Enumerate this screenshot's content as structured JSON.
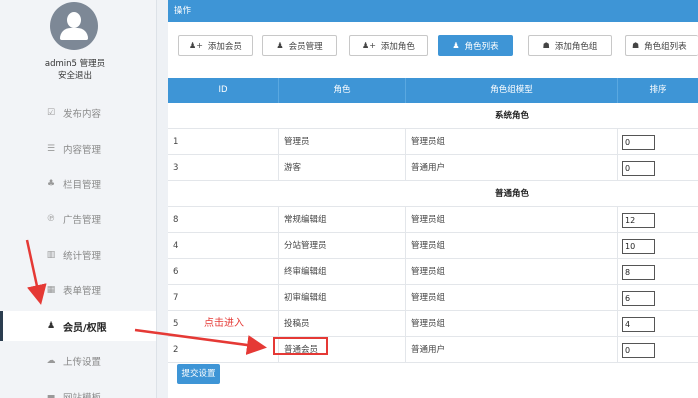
{
  "sidebar": {
    "user": {
      "name": "admin5 管理员",
      "logout": "安全退出"
    },
    "items": [
      {
        "label": "发布内容",
        "icon": "edit-icon",
        "glyph": "☑"
      },
      {
        "label": "内容管理",
        "icon": "list-icon",
        "glyph": "☰"
      },
      {
        "label": "栏目管理",
        "icon": "sitemap-icon",
        "glyph": "♣"
      },
      {
        "label": "广告管理",
        "icon": "pin-icon",
        "glyph": "℗"
      },
      {
        "label": "统计管理",
        "icon": "bar-chart-icon",
        "glyph": "▥"
      },
      {
        "label": "表单管理",
        "icon": "table-icon",
        "glyph": "▦"
      },
      {
        "label": "会员/权限",
        "icon": "user-icon",
        "glyph": "♟"
      },
      {
        "label": "上传设置",
        "icon": "cloud-upload-icon",
        "glyph": "☁"
      },
      {
        "label": "网站模板",
        "icon": "template-icon",
        "glyph": "▬"
      }
    ]
  },
  "main": {
    "header": "操作",
    "buttons": [
      {
        "label": "添加会员",
        "icon": "add-user-icon",
        "glyph": "♟+"
      },
      {
        "label": "会员管理",
        "icon": "user-icon",
        "glyph": "♟"
      },
      {
        "label": "添加角色",
        "icon": "add-user-icon",
        "glyph": "♟+"
      },
      {
        "label": "角色列表",
        "icon": "user-icon",
        "glyph": "♟"
      },
      {
        "label": "添加角色组",
        "icon": "group-icon",
        "glyph": "☗"
      },
      {
        "label": "角色组列表",
        "icon": "group-icon",
        "glyph": "☗"
      }
    ],
    "table": {
      "columns": [
        "ID",
        "角色",
        "角色组模型",
        "排序"
      ],
      "groups": [
        {
          "title": "系统角色",
          "rows": [
            {
              "id": "1",
              "role": "管理员",
              "model": "管理员组",
              "sort": "0"
            },
            {
              "id": "3",
              "role": "游客",
              "model": "普通用户",
              "sort": "0"
            }
          ]
        },
        {
          "title": "普通角色",
          "rows": [
            {
              "id": "8",
              "role": "常规编辑组",
              "model": "管理员组",
              "sort": "12"
            },
            {
              "id": "4",
              "role": "分站管理员",
              "model": "管理员组",
              "sort": "10"
            },
            {
              "id": "6",
              "role": "终审编辑组",
              "model": "管理员组",
              "sort": "8"
            },
            {
              "id": "7",
              "role": "初审编辑组",
              "model": "管理员组",
              "sort": "6"
            },
            {
              "id": "5",
              "role": "投稿员",
              "model": "管理员组",
              "sort": "4"
            },
            {
              "id": "2",
              "role": "普通会员",
              "model": "普通用户",
              "sort": "0"
            }
          ]
        }
      ]
    },
    "submit_label": "提交设置"
  },
  "annotation": {
    "text": "点击进入",
    "color": "#e53935"
  },
  "colors": {
    "accent": "#3e95d6",
    "sidebar_bg": "#f2f4f7",
    "annotation": "#e53935"
  }
}
